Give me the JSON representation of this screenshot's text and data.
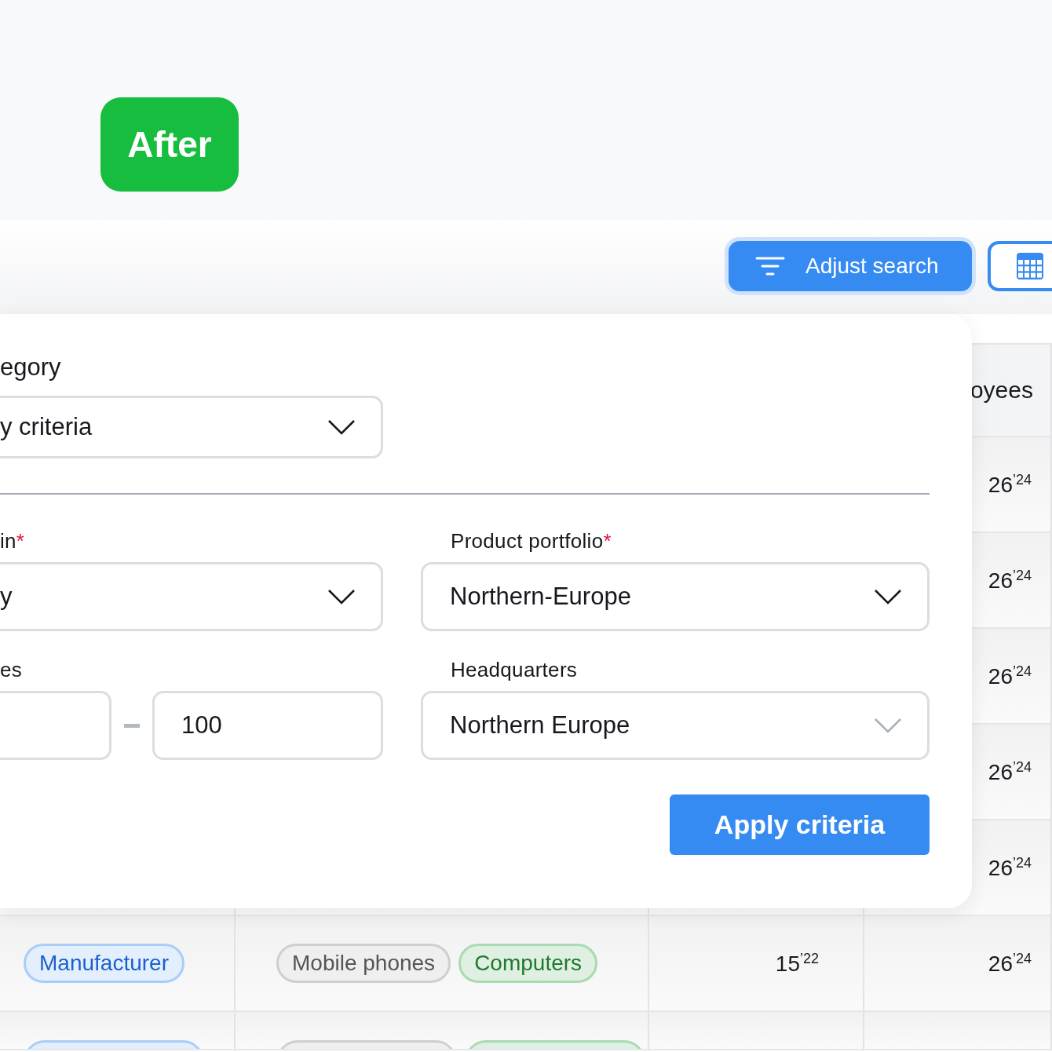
{
  "badge": {
    "label": "After"
  },
  "toolbar": {
    "buttons": [
      {
        "kind": "primary",
        "label": "Adjust search"
      },
      {
        "kind": "grid-view"
      }
    ]
  },
  "table": {
    "column_4_heading": "oyees",
    "rows": [
      {
        "column_4": "26$^{’24}$"
      },
      {
        "column_4": "26$^{’24}$"
      },
      {
        "column_4": "26$^{’24}$"
      },
      {
        "column_4": "26$^{’24}$"
      },
      {
        "column_4": "26$^{’24}$"
      },
      {
        "type_tags": [
          {
            "kind": "type",
            "label": "Manufacturer"
          }
        ],
        "product_tags": [
          {
            "kind": "product",
            "label": "Mobile phones"
          },
          {
            "kind": "category",
            "label": "Computers"
          }
        ],
        "column_3": "15$^{’22}$",
        "column_4": "26$^{’24}$"
      },
      {
        "type_tags": [
          {
            "kind": "type"
          }
        ],
        "product_tags": [
          {
            "kind": "product"
          },
          {
            "kind": "category"
          }
        ]
      }
    ]
  },
  "panel": {
    "category": {
      "label": "egory",
      "value": "y criteria"
    },
    "rows": [
      [
        {
          "kind": "select",
          "label": "in",
          "required_mark": "*",
          "value": "y",
          "chevron_muted": false
        },
        {
          "kind": "select",
          "label": "Product portfolio",
          "required_mark": "*",
          "value": "Northern-Europe",
          "chevron_muted": false
        }
      ],
      [
        {
          "kind": "range",
          "label": "es",
          "max": "100"
        },
        {
          "kind": "select",
          "label": "Headquarters",
          "value": "Northern Europe",
          "chevron_muted": true
        }
      ]
    ],
    "apply_button": "Apply criteria"
  }
}
